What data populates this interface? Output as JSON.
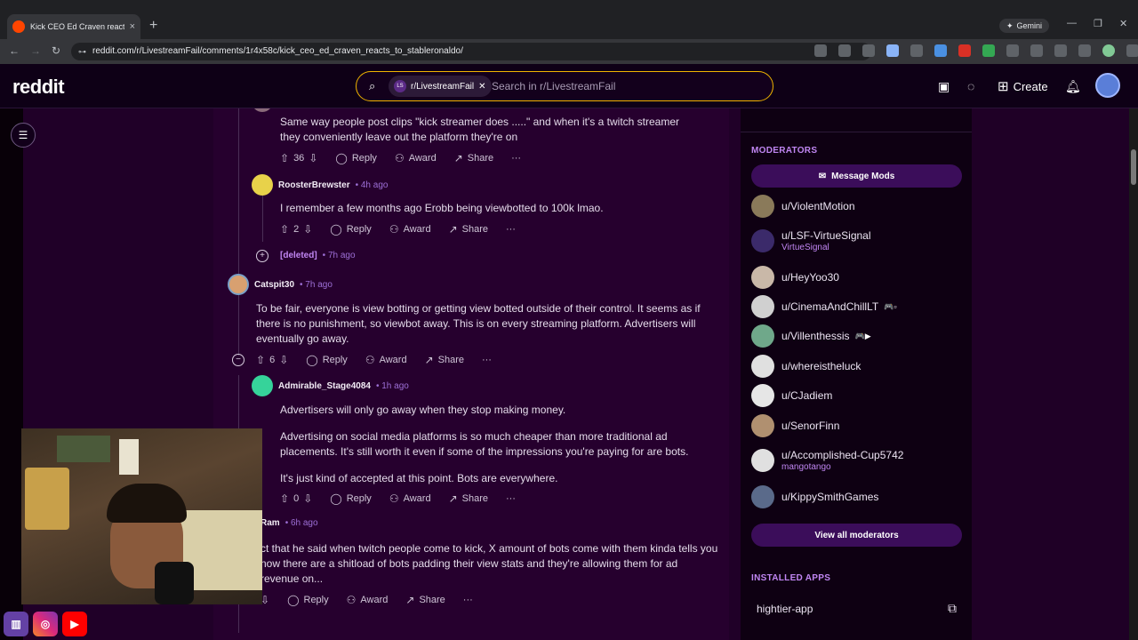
{
  "browser": {
    "tab_title": "Kick CEO Ed Craven reacts to St",
    "tab_close": "×",
    "new_tab": "+",
    "gemini_label": "Gemini",
    "url": "reddit.com/r/LivestreamFail/comments/1r4x58c/kick_ceo_ed_craven_reacts_to_stableronaldo/"
  },
  "header": {
    "logo": "reddit",
    "search_chip": "r/LivestreamFail",
    "search_chip_icon": "LS",
    "search_placeholder": "Search in r/LivestreamFail",
    "create_label": "Create"
  },
  "comments": [
    {
      "body": "Same way people post clips \"kick streamer does .....\" and when it's a twitch streamer they conveniently leave out the platform they're on",
      "votes": "36"
    },
    {
      "author": "RoosterBrewster",
      "time": "• 4h ago",
      "body": "I remember a few months ago Erobb being viewbotted to 100k lmao.",
      "votes": "2"
    },
    {
      "author": "[deleted]",
      "time": "• 7h ago"
    },
    {
      "author": "Catspit30",
      "time": "• 7h ago",
      "body": "To be fair, everyone is view botting or getting view botted outside of their control. It seems as if there is no punishment, so viewbot away. This is on every streaming platform. Advertisers will eventually go away.",
      "votes": "6"
    },
    {
      "author": "Admirable_Stage4084",
      "time": "• 1h ago",
      "body_p1": "Advertisers will only go away when they stop making money.",
      "body_p2": "Advertising on social media platforms is so much cheaper than more traditional ad placements. It's still worth it even if some of the impressions you're paying for are bots.",
      "body_p3": "It's just kind of accepted at this point. Bots are everywhere.",
      "votes": "0"
    },
    {
      "author": "Ram",
      "time": "• 6h ago",
      "body": "ct that he said when twitch people come to kick, X amount of bots come with them kinda tells you now there are a shitload of bots padding their view stats and they're allowing them for ad revenue on..."
    }
  ],
  "actions": {
    "reply": "Reply",
    "award": "Award",
    "share": "Share",
    "more": "···"
  },
  "sidebar": {
    "moderators_heading": "MODERATORS",
    "message_mods": "Message Mods",
    "moderators": [
      {
        "name": "u/ViolentMotion",
        "flair": "",
        "color": "#8a7a5a"
      },
      {
        "name": "u/LSF-VirtueSignal",
        "flair": "VirtueSignal",
        "color": "#3b2a6a"
      },
      {
        "name": "u/HeyYoo30",
        "flair": "",
        "color": "#c9b8a8"
      },
      {
        "name": "u/CinemaAndChillLT",
        "flair": "",
        "color": "#d0d0d0"
      },
      {
        "name": "u/Villenthessis",
        "flair": "",
        "color": "#6fa88a"
      },
      {
        "name": "u/whereistheluck",
        "flair": "",
        "color": "#e0e0e0"
      },
      {
        "name": "u/CJadiem",
        "flair": "",
        "color": "#e6e6e6"
      },
      {
        "name": "u/SenorFinn",
        "flair": "",
        "color": "#b09070"
      },
      {
        "name": "u/Accomplished-Cup5742",
        "flair": "mangotango",
        "color": "#e0e0e0"
      },
      {
        "name": "u/KippySmithGames",
        "flair": "",
        "color": "#5a6a8a"
      }
    ],
    "view_all": "View all moderators",
    "installed_heading": "INSTALLED APPS",
    "app_name": "hightier-app"
  },
  "overlay": {
    "social": [
      "twitch",
      "instagram",
      "youtube"
    ]
  }
}
